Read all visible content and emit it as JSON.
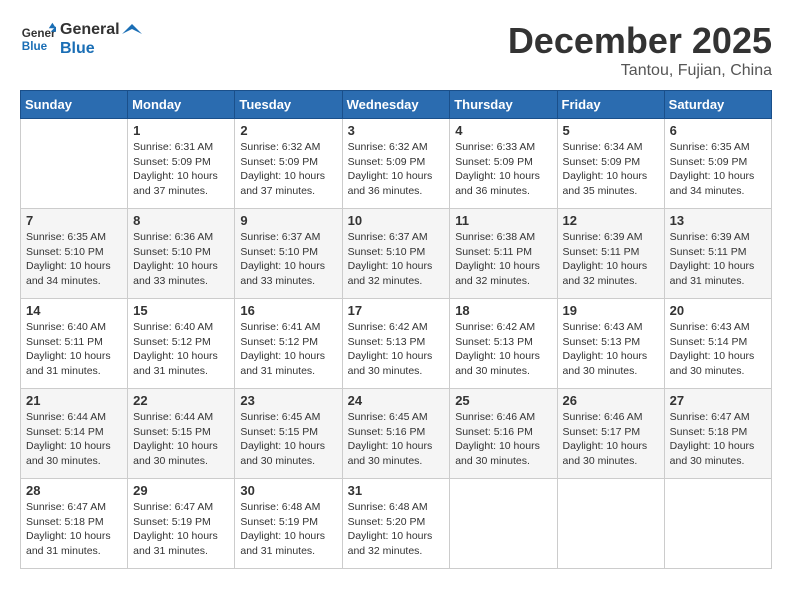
{
  "header": {
    "logo_general": "General",
    "logo_blue": "Blue",
    "month_title": "December 2025",
    "subtitle": "Tantou, Fujian, China"
  },
  "days_of_week": [
    "Sunday",
    "Monday",
    "Tuesday",
    "Wednesday",
    "Thursday",
    "Friday",
    "Saturday"
  ],
  "weeks": [
    [
      {
        "day": "",
        "info": ""
      },
      {
        "day": "1",
        "info": "Sunrise: 6:31 AM\nSunset: 5:09 PM\nDaylight: 10 hours\nand 37 minutes."
      },
      {
        "day": "2",
        "info": "Sunrise: 6:32 AM\nSunset: 5:09 PM\nDaylight: 10 hours\nand 37 minutes."
      },
      {
        "day": "3",
        "info": "Sunrise: 6:32 AM\nSunset: 5:09 PM\nDaylight: 10 hours\nand 36 minutes."
      },
      {
        "day": "4",
        "info": "Sunrise: 6:33 AM\nSunset: 5:09 PM\nDaylight: 10 hours\nand 36 minutes."
      },
      {
        "day": "5",
        "info": "Sunrise: 6:34 AM\nSunset: 5:09 PM\nDaylight: 10 hours\nand 35 minutes."
      },
      {
        "day": "6",
        "info": "Sunrise: 6:35 AM\nSunset: 5:09 PM\nDaylight: 10 hours\nand 34 minutes."
      }
    ],
    [
      {
        "day": "7",
        "info": "Sunrise: 6:35 AM\nSunset: 5:10 PM\nDaylight: 10 hours\nand 34 minutes."
      },
      {
        "day": "8",
        "info": "Sunrise: 6:36 AM\nSunset: 5:10 PM\nDaylight: 10 hours\nand 33 minutes."
      },
      {
        "day": "9",
        "info": "Sunrise: 6:37 AM\nSunset: 5:10 PM\nDaylight: 10 hours\nand 33 minutes."
      },
      {
        "day": "10",
        "info": "Sunrise: 6:37 AM\nSunset: 5:10 PM\nDaylight: 10 hours\nand 32 minutes."
      },
      {
        "day": "11",
        "info": "Sunrise: 6:38 AM\nSunset: 5:11 PM\nDaylight: 10 hours\nand 32 minutes."
      },
      {
        "day": "12",
        "info": "Sunrise: 6:39 AM\nSunset: 5:11 PM\nDaylight: 10 hours\nand 32 minutes."
      },
      {
        "day": "13",
        "info": "Sunrise: 6:39 AM\nSunset: 5:11 PM\nDaylight: 10 hours\nand 31 minutes."
      }
    ],
    [
      {
        "day": "14",
        "info": "Sunrise: 6:40 AM\nSunset: 5:11 PM\nDaylight: 10 hours\nand 31 minutes."
      },
      {
        "day": "15",
        "info": "Sunrise: 6:40 AM\nSunset: 5:12 PM\nDaylight: 10 hours\nand 31 minutes."
      },
      {
        "day": "16",
        "info": "Sunrise: 6:41 AM\nSunset: 5:12 PM\nDaylight: 10 hours\nand 31 minutes."
      },
      {
        "day": "17",
        "info": "Sunrise: 6:42 AM\nSunset: 5:13 PM\nDaylight: 10 hours\nand 30 minutes."
      },
      {
        "day": "18",
        "info": "Sunrise: 6:42 AM\nSunset: 5:13 PM\nDaylight: 10 hours\nand 30 minutes."
      },
      {
        "day": "19",
        "info": "Sunrise: 6:43 AM\nSunset: 5:13 PM\nDaylight: 10 hours\nand 30 minutes."
      },
      {
        "day": "20",
        "info": "Sunrise: 6:43 AM\nSunset: 5:14 PM\nDaylight: 10 hours\nand 30 minutes."
      }
    ],
    [
      {
        "day": "21",
        "info": "Sunrise: 6:44 AM\nSunset: 5:14 PM\nDaylight: 10 hours\nand 30 minutes."
      },
      {
        "day": "22",
        "info": "Sunrise: 6:44 AM\nSunset: 5:15 PM\nDaylight: 10 hours\nand 30 minutes."
      },
      {
        "day": "23",
        "info": "Sunrise: 6:45 AM\nSunset: 5:15 PM\nDaylight: 10 hours\nand 30 minutes."
      },
      {
        "day": "24",
        "info": "Sunrise: 6:45 AM\nSunset: 5:16 PM\nDaylight: 10 hours\nand 30 minutes."
      },
      {
        "day": "25",
        "info": "Sunrise: 6:46 AM\nSunset: 5:16 PM\nDaylight: 10 hours\nand 30 minutes."
      },
      {
        "day": "26",
        "info": "Sunrise: 6:46 AM\nSunset: 5:17 PM\nDaylight: 10 hours\nand 30 minutes."
      },
      {
        "day": "27",
        "info": "Sunrise: 6:47 AM\nSunset: 5:18 PM\nDaylight: 10 hours\nand 30 minutes."
      }
    ],
    [
      {
        "day": "28",
        "info": "Sunrise: 6:47 AM\nSunset: 5:18 PM\nDaylight: 10 hours\nand 31 minutes."
      },
      {
        "day": "29",
        "info": "Sunrise: 6:47 AM\nSunset: 5:19 PM\nDaylight: 10 hours\nand 31 minutes."
      },
      {
        "day": "30",
        "info": "Sunrise: 6:48 AM\nSunset: 5:19 PM\nDaylight: 10 hours\nand 31 minutes."
      },
      {
        "day": "31",
        "info": "Sunrise: 6:48 AM\nSunset: 5:20 PM\nDaylight: 10 hours\nand 32 minutes."
      },
      {
        "day": "",
        "info": ""
      },
      {
        "day": "",
        "info": ""
      },
      {
        "day": "",
        "info": ""
      }
    ]
  ]
}
